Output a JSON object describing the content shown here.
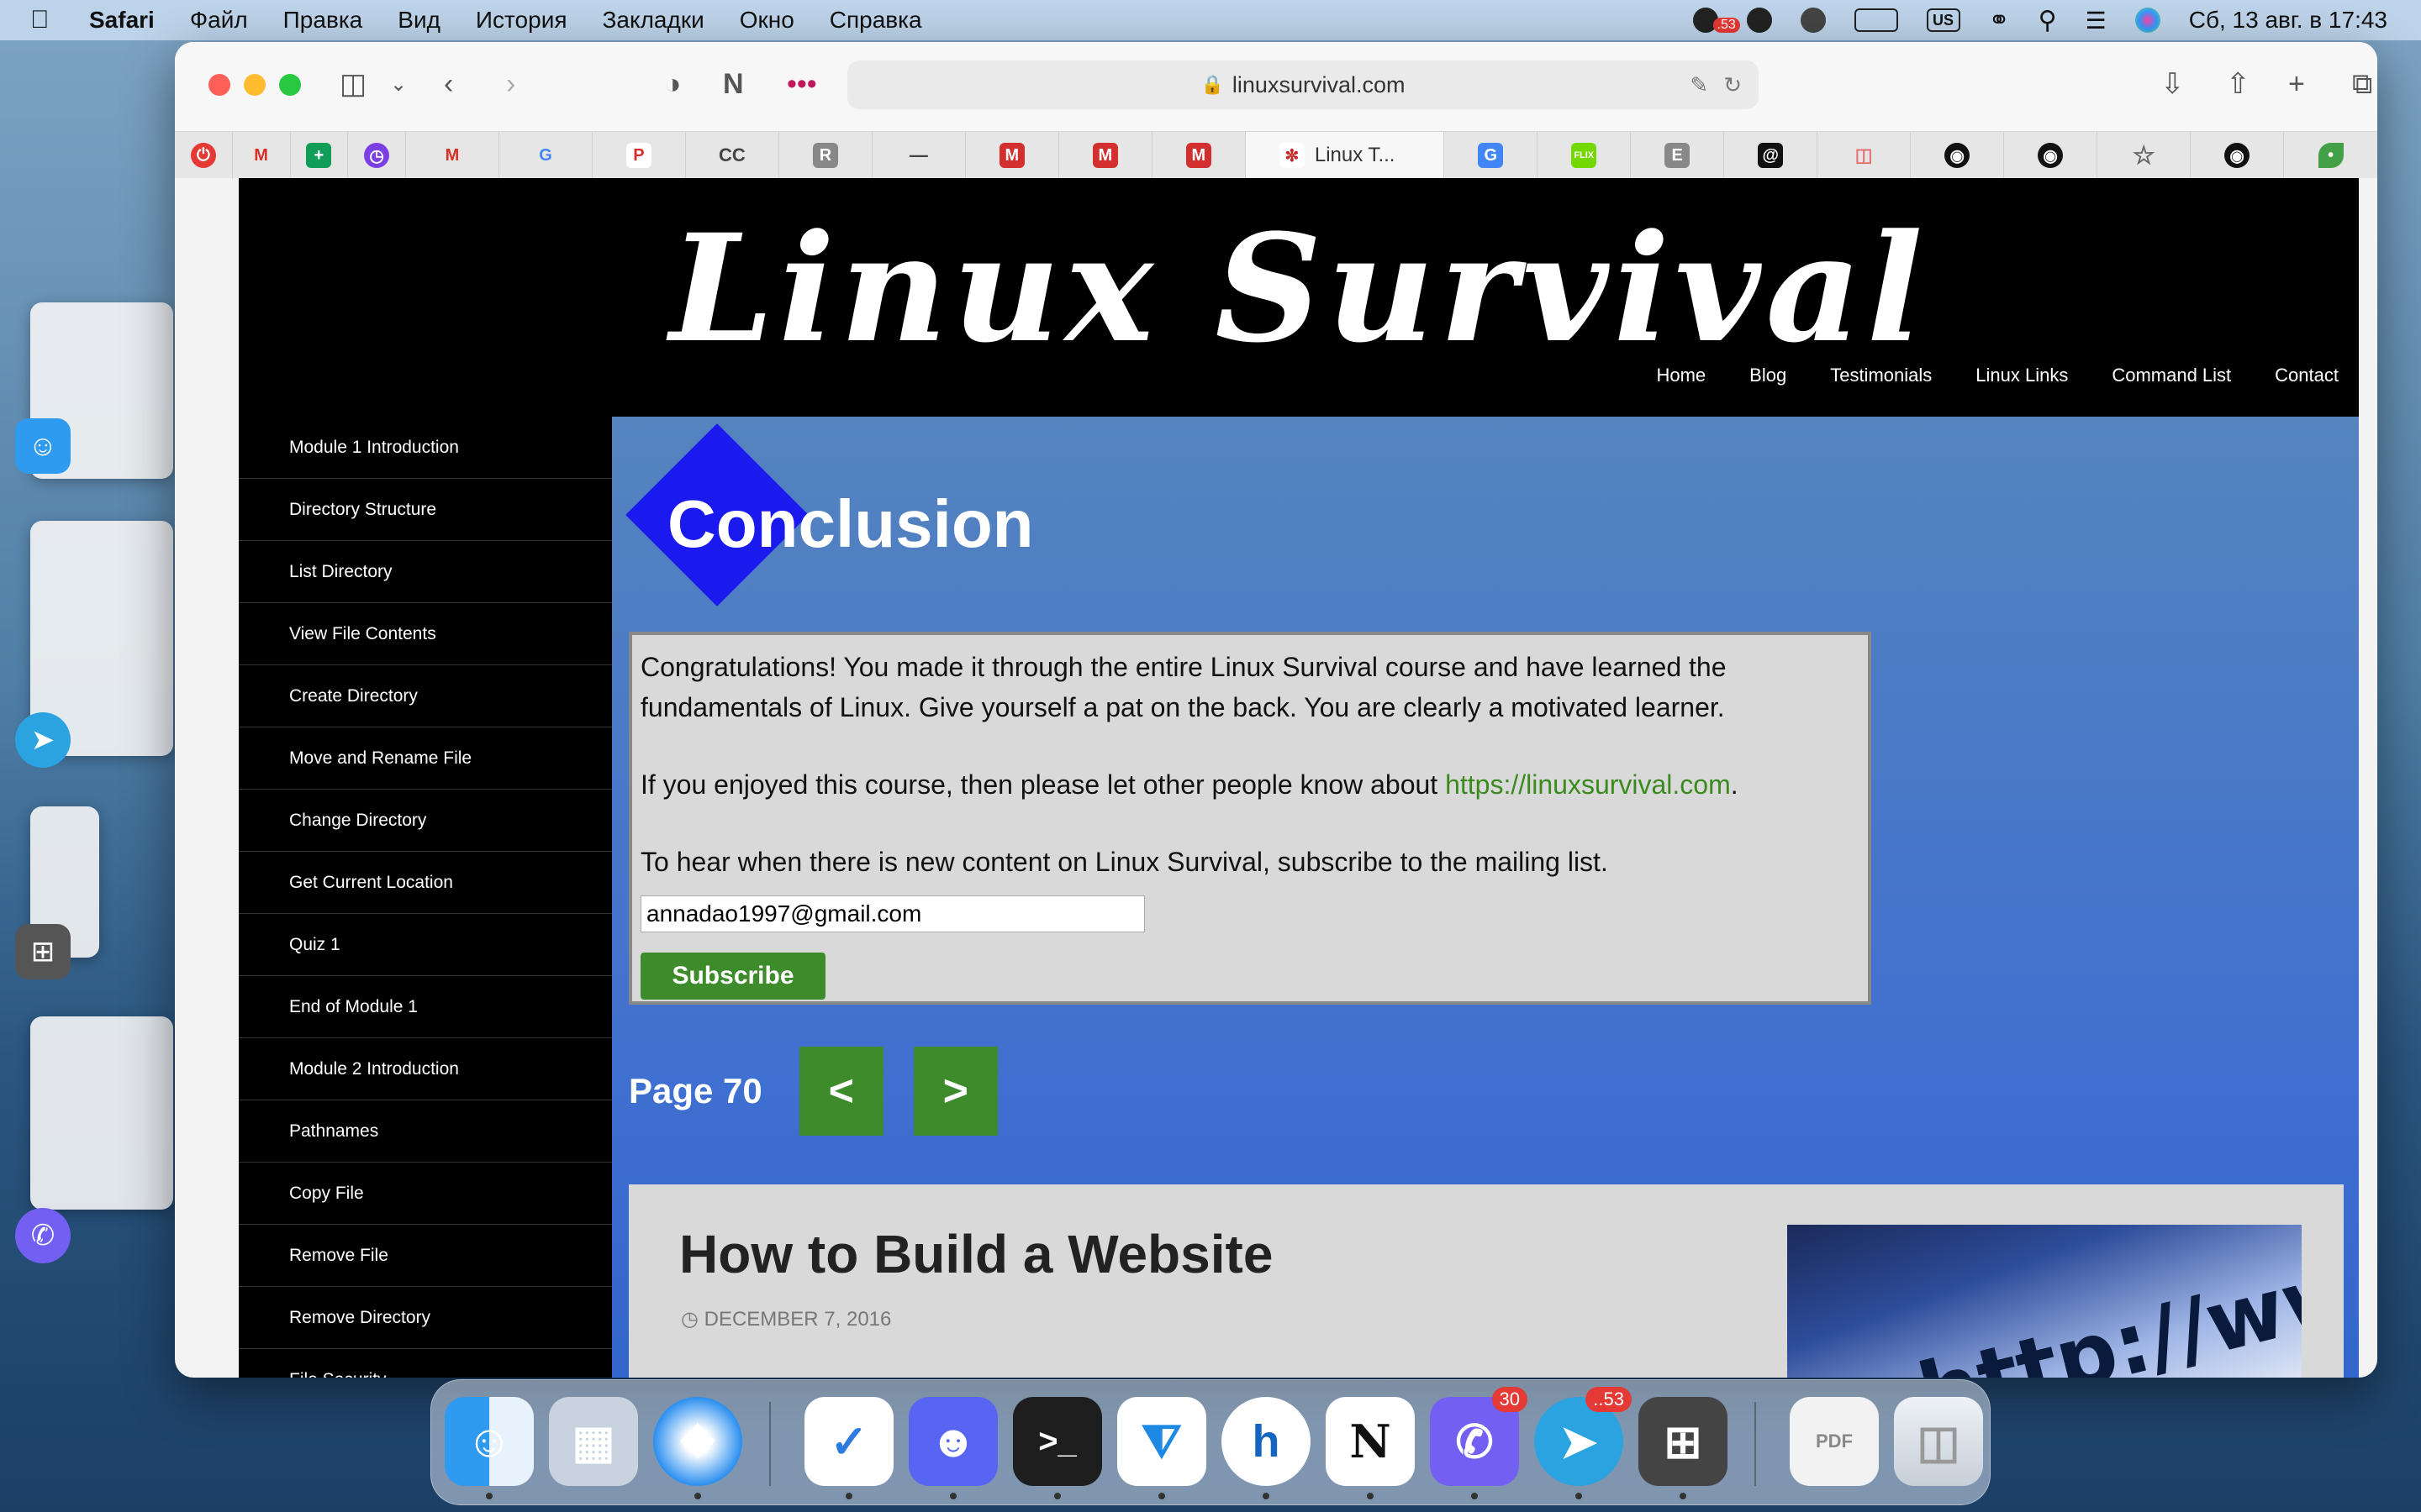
{
  "menubar": {
    "app_name": "Safari",
    "items": [
      "Файл",
      "Правка",
      "Вид",
      "История",
      "Закладки",
      "Окно",
      "Справка"
    ],
    "status": {
      "input_source": "US",
      "badge": ".53",
      "datetime": "Сб, 13 авг. в 17:43"
    }
  },
  "browser": {
    "url": "linuxsurvival.com",
    "active_tab_title": "Linux T...",
    "tab_favicons": [
      "power",
      "gmail",
      "sheets",
      "clock",
      "gmail",
      "google",
      "P",
      "CC",
      "R",
      "dash",
      "M",
      "M",
      "M",
      "Linux T...",
      "translate",
      "FLIX BUS",
      "E",
      "at",
      "car",
      "github",
      "github",
      "star",
      "github",
      "leaf"
    ]
  },
  "site": {
    "title": "Linux Survival",
    "nav": [
      "Home",
      "Blog",
      "Testimonials",
      "Linux Links",
      "Command List",
      "Contact"
    ],
    "sidebar": [
      "Module 1 Introduction",
      "Directory Structure",
      "List Directory",
      "View File Contents",
      "Create Directory",
      "Move and Rename File",
      "Change Directory",
      "Get Current Location",
      "Quiz 1",
      "End of Module 1",
      "Module 2 Introduction",
      "Pathnames",
      "Copy File",
      "Remove File",
      "Remove Directory",
      "File Security"
    ],
    "heading": "Conclusion",
    "para1": "Congratulations! You made it through the entire Linux Survival course and have learned the fundamentals of Linux. Give yourself a pat on the back. You are clearly a motivated learner.",
    "para2_prefix": "If you enjoyed this course, then please let other people know about ",
    "para2_link": "https://linuxsurvival.com",
    "para2_suffix": ".",
    "para3": "To hear when there is new content on Linux Survival, subscribe to the mailing list.",
    "email_value": "annadao1997@gmail.com",
    "subscribe_label": "Subscribe",
    "page_label": "Page 70",
    "prev_label": "<",
    "next_label": ">",
    "blog_title": "How to Build a Website",
    "blog_date": "DECEMBER 7, 2016",
    "blog_image_text": "http://www"
  },
  "dock": {
    "apps": [
      "finder",
      "launchpad",
      "safari",
      "tasks",
      "discord",
      "terminal",
      "vscode",
      "h-app",
      "notion",
      "viber",
      "telegram",
      "calculator",
      "pdf",
      "trash"
    ],
    "badges": {
      "viber": "30",
      "telegram": "..53"
    }
  },
  "colors": {
    "link_green": "#3a8a1e",
    "button_green": "#3d8b2a",
    "main_blue": "#3f6fd0",
    "diamond_blue": "#1a1aee"
  }
}
